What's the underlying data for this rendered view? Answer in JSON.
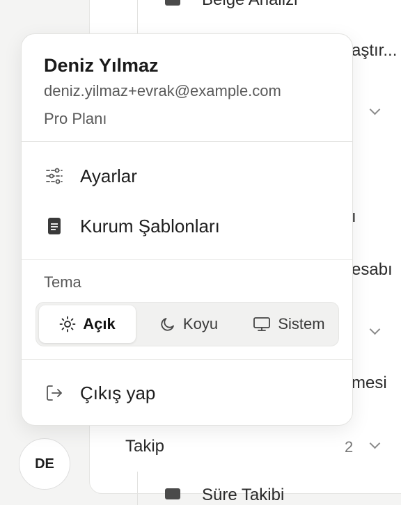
{
  "background": {
    "items": [
      {
        "label": "Belge Analizi"
      },
      {
        "label": "aştır..."
      },
      {
        "label": "ı"
      },
      {
        "label": "esabı"
      },
      {
        "label": "mesi"
      },
      {
        "label": "Takip",
        "count": "2"
      },
      {
        "label": "Süre Takibi"
      }
    ]
  },
  "avatar": {
    "initials": "DE"
  },
  "user": {
    "name": "Deniz Yılmaz",
    "email": "deniz.yilmaz+evrak@example.com",
    "plan": "Pro Planı"
  },
  "menu": {
    "items": [
      {
        "label": "Ayarlar",
        "icon": "sliders-icon"
      },
      {
        "label": "Kurum Şablonları",
        "icon": "document-icon"
      }
    ],
    "theme": {
      "label": "Tema",
      "options": [
        {
          "label": "Açık",
          "icon": "sun-icon"
        },
        {
          "label": "Koyu",
          "icon": "moon-icon"
        },
        {
          "label": "Sistem",
          "icon": "monitor-icon"
        }
      ],
      "selected": "Açık"
    },
    "logout": {
      "label": "Çıkış yap",
      "icon": "logout-icon"
    }
  }
}
